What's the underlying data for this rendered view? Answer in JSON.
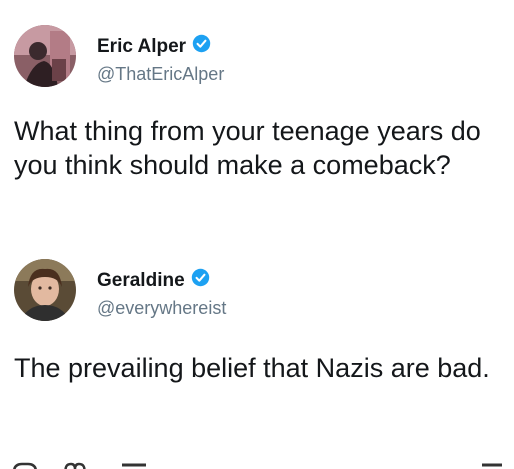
{
  "tweets": [
    {
      "display_name": "Eric Alper",
      "handle": "@ThatEricAlper",
      "verified_icon": "verified-badge-icon",
      "text": "What thing from your teenage years do you think should make a comeback?"
    },
    {
      "display_name": "Geraldine",
      "handle": "@everywhereist",
      "verified_icon": "verified-badge-icon",
      "text": "The prevailing belief that Nazis are bad."
    }
  ],
  "actions": {
    "icons": [
      "reply-icon",
      "like-icon",
      "share-icon"
    ]
  },
  "colors": {
    "text": "#14171a",
    "secondary": "#657786",
    "verified": "#1da1f2"
  }
}
